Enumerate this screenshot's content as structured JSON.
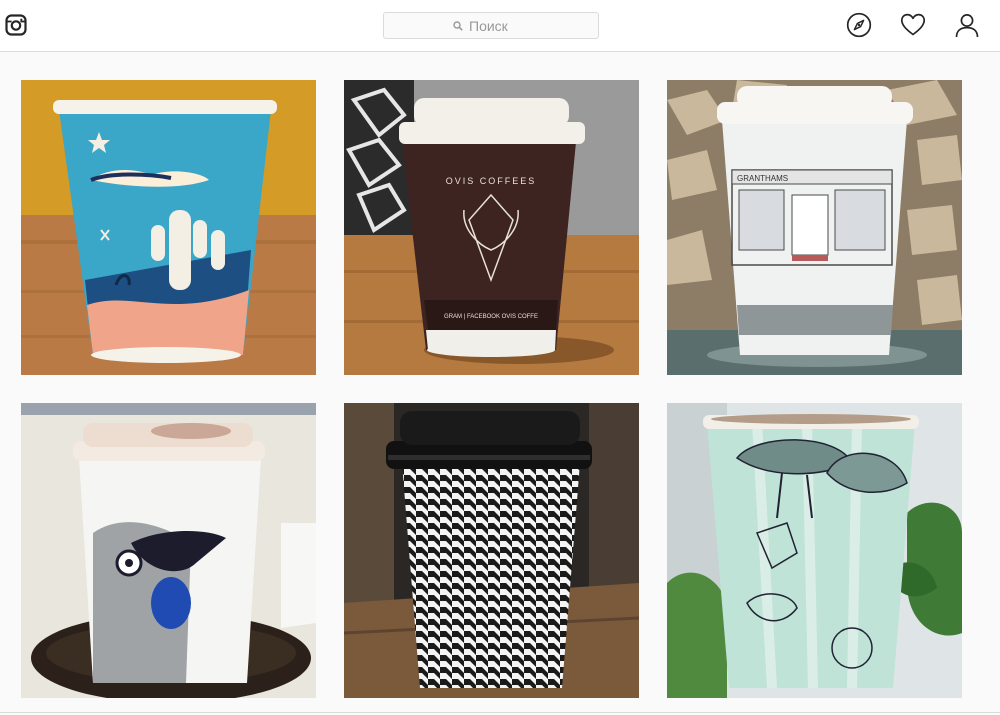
{
  "header": {
    "logo_icon": "instagram-camera-icon",
    "search": {
      "placeholder": "Поиск",
      "icon": "search-icon"
    },
    "nav_icons": [
      "compass-icon",
      "heart-icon",
      "user-icon"
    ]
  },
  "posts": [
    {
      "subject": "desert-illustration-paper-cup"
    },
    {
      "subject": "ovis-coffees-paper-cup",
      "cup_text": "OVIS COFFEES",
      "band_text": "GRAM | FACEBOOK OVIS COFFE"
    },
    {
      "subject": "granthams-storefront-paper-cup",
      "cup_text": "GRANTHAMS"
    },
    {
      "subject": "bird-illustration-paper-cup"
    },
    {
      "subject": "houndstooth-paper-cup"
    },
    {
      "subject": "vintage-mushroom-illustration-paper-cup"
    }
  ],
  "colors": {
    "accent_text": "#999999",
    "border": "#dbdbdb",
    "background": "#fafafa"
  }
}
